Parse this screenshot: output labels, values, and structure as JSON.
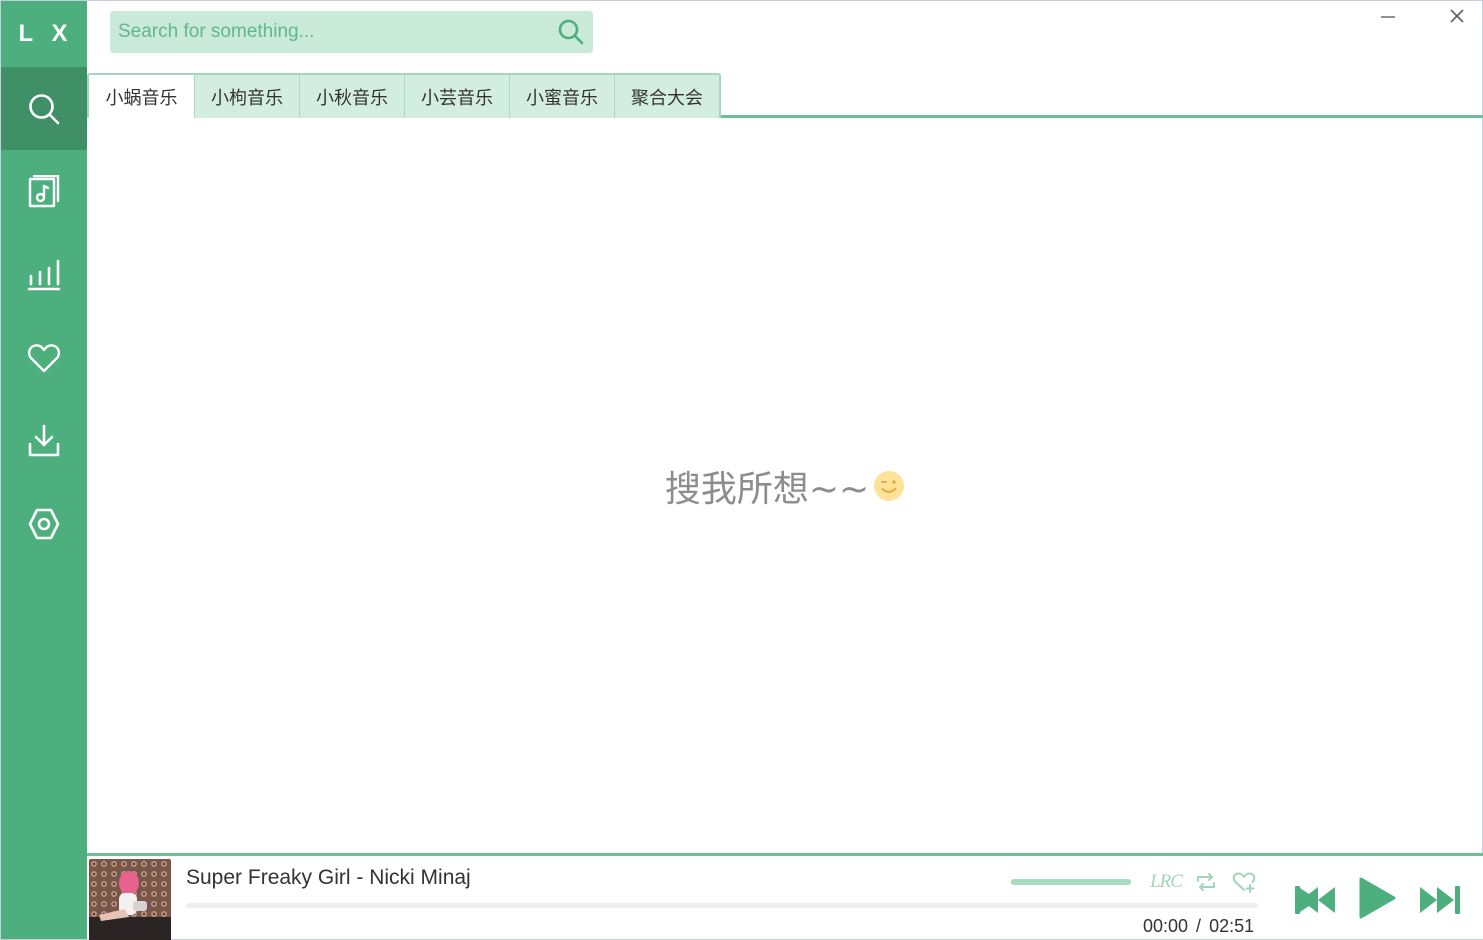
{
  "app": {
    "logo": "L X"
  },
  "sidebar": {
    "items": [
      {
        "name": "search",
        "icon": "search-icon",
        "active": true
      },
      {
        "name": "song-list",
        "icon": "music-file-icon",
        "active": false
      },
      {
        "name": "leaderboard",
        "icon": "bar-chart-icon",
        "active": false
      },
      {
        "name": "favorites",
        "icon": "heart-icon",
        "active": false
      },
      {
        "name": "download",
        "icon": "download-icon",
        "active": false
      },
      {
        "name": "settings",
        "icon": "hexagon-settings-icon",
        "active": false
      }
    ]
  },
  "window": {
    "minimize_icon": "minimize-icon",
    "close_icon": "close-icon"
  },
  "search": {
    "placeholder": "Search for something...",
    "value": ""
  },
  "tabs": [
    {
      "label": "小蜗音乐",
      "active": true
    },
    {
      "label": "小枸音乐",
      "active": false
    },
    {
      "label": "小秋音乐",
      "active": false
    },
    {
      "label": "小芸音乐",
      "active": false
    },
    {
      "label": "小蜜音乐",
      "active": false
    },
    {
      "label": "聚合大会",
      "active": false
    }
  ],
  "main": {
    "empty_text": "搜我所想~~"
  },
  "player": {
    "song": "Super Freaky Girl - Nicki Minaj",
    "current_time": "00:00",
    "separator": "/",
    "total_time": "02:51",
    "lrc_label": "LRC",
    "progress": 0,
    "volume": 1.0
  },
  "colors": {
    "accent": "#4caf7d",
    "accent_dark": "#3f8f67",
    "tab_bg": "#d3eee1",
    "search_bg": "#c9e9d9"
  }
}
